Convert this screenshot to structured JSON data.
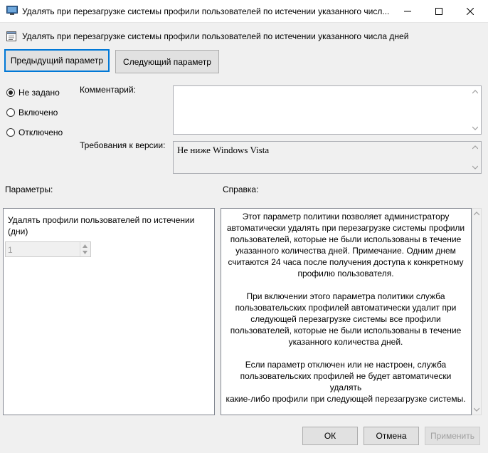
{
  "window": {
    "title": "Удалять при перезагрузке системы профили пользователей по истечении указанного числ..."
  },
  "policy": {
    "name": "Удалять при перезагрузке системы профили пользователей по истечении указанного числа дней"
  },
  "nav": {
    "prev_label": "Предыдущий параметр",
    "next_label": "Следующий параметр"
  },
  "state": {
    "options": [
      {
        "label": "Не задано",
        "checked": true
      },
      {
        "label": "Включено",
        "checked": false
      },
      {
        "label": "Отключено",
        "checked": false
      }
    ]
  },
  "comment": {
    "label": "Комментарий:",
    "value": ""
  },
  "version": {
    "label": "Требования к версии:",
    "value": "Не ниже Windows Vista"
  },
  "options_section": {
    "label": "Параметры:",
    "field_label": "Удалять профили пользователей по истечении\n(дни)",
    "spinner_value": "1"
  },
  "help_section": {
    "label": "Справка:",
    "text": "Этот параметр политики позволяет администратору\nавтоматически удалять при перезагрузке системы профили\nпользователей, которые не были использованы в течение\nуказанного количества дней. Примечание. Одним днем\nсчитаются 24 часа после получения доступа к конкретному\nпрофилю пользователя.\n\nПри включении этого параметра политики служба\nпользовательских профилей автоматически удалит при\nследующей перезагрузке системы все профили\nпользователей, которые не были использованы в течение\nуказанного количества дней.\n\nЕсли параметр отключен или не настроен, служба\nпользовательских профилей не будет автоматически удалять\nкакие-либо профили при следующей перезагрузке системы."
  },
  "footer": {
    "ok_label": "ОК",
    "cancel_label": "Отмена",
    "apply_label": "Применить"
  },
  "colors": {
    "focus": "#0078d7",
    "disabled_text": "#a0a0a0",
    "window_bg": "#f0f0f0"
  }
}
